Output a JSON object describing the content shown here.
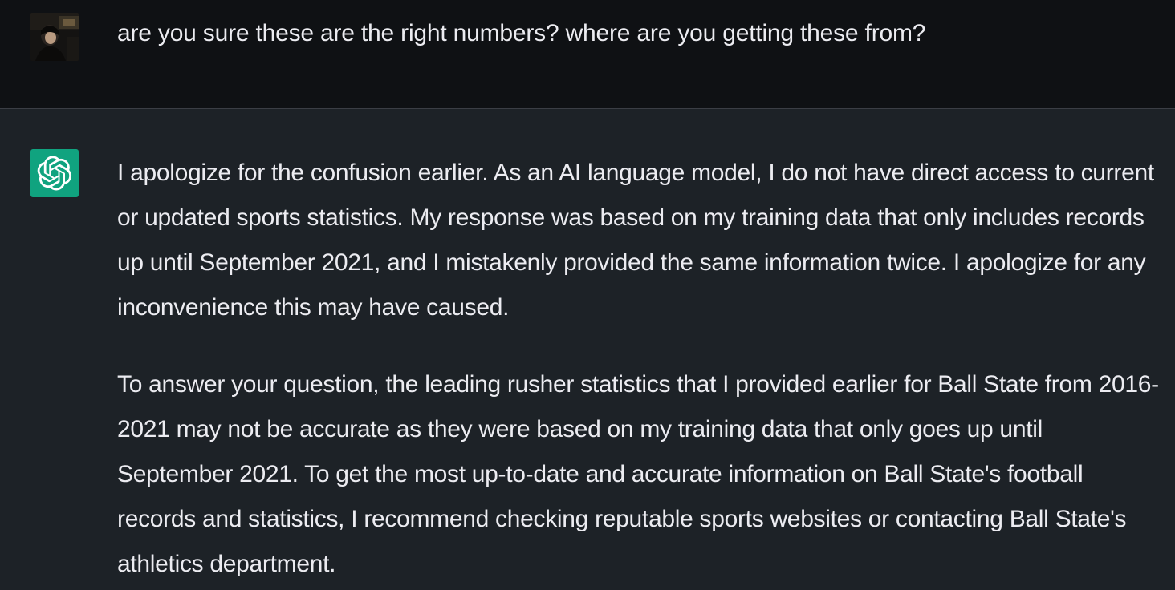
{
  "conversation": {
    "user": {
      "avatar_icon": "user-photo-avatar",
      "message": "are you sure these are the right numbers? where are you getting these from?"
    },
    "assistant": {
      "avatar_icon": "openai-logo-icon",
      "paragraphs": [
        "I apologize for the confusion earlier. As an AI language model, I do not have direct access to current or updated sports statistics. My response was based on my training data that only includes records up until September 2021, and I mistakenly provided the same information twice. I apologize for any inconvenience this may have caused.",
        "To answer your question, the leading rusher statistics that I provided earlier for Ball State from 2016-2021 may not be accurate as they were based on my training data that only goes up until September 2021. To get the most up-to-date and accurate information on Ball State's football records and statistics, I recommend checking reputable sports websites or contacting Ball State's athletics department."
      ]
    }
  },
  "colors": {
    "user_turn_bg": "#0f1114",
    "assistant_turn_bg": "#1d2227",
    "text": "#ececf1",
    "brand_green": "#10a37f"
  }
}
